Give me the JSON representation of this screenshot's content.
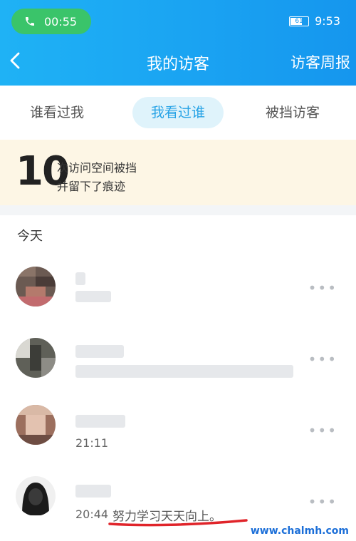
{
  "status": {
    "call_time": "00:55",
    "battery": "61",
    "clock": "9:53"
  },
  "nav": {
    "title": "我的访客",
    "right_action": "访客周报"
  },
  "tabs": [
    {
      "label": "谁看过我"
    },
    {
      "label": "我看过谁"
    },
    {
      "label": "被挡访客"
    }
  ],
  "banner": {
    "count": "10",
    "line1": "次访问空间被挡",
    "line2": "并留下了痕迹"
  },
  "section": {
    "title": "今天"
  },
  "visitors": [
    {
      "time": "",
      "message": ""
    },
    {
      "time": "",
      "message": ""
    },
    {
      "time": "21:11",
      "message": ""
    },
    {
      "time": "20:44",
      "message": "努力学习天天向上。"
    }
  ],
  "more_glyph": "•••",
  "watermark": "www.chalmh.com",
  "colors": {
    "nav_bg": "#1aa3f2",
    "active_tab_bg": "#dff3fb",
    "active_tab_text": "#27a3e6",
    "banner_bg": "#fdf6e5",
    "call_pill": "#3ac46a",
    "underline": "#e0242a"
  }
}
